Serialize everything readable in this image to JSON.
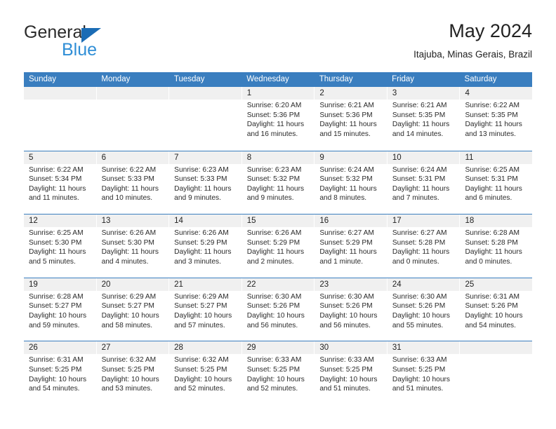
{
  "brand": {
    "name_top": "General",
    "name_bottom": "Blue",
    "triangle_color": "#1b6cb5",
    "blue_text_color": "#2f8ed6"
  },
  "header": {
    "title": "May 2024",
    "subtitle": "Itajuba, Minas Gerais, Brazil"
  },
  "theme": {
    "header_blue": "#3a7ebf",
    "day_band_gray": "#f0f0f0",
    "text": "#222222"
  },
  "calendar": {
    "weekdays": [
      "Sunday",
      "Monday",
      "Tuesday",
      "Wednesday",
      "Thursday",
      "Friday",
      "Saturday"
    ],
    "weeks": [
      [
        {
          "day": "",
          "sunrise": "",
          "sunset": "",
          "daylight": "",
          "daylight2": "",
          "empty": true
        },
        {
          "day": "",
          "sunrise": "",
          "sunset": "",
          "daylight": "",
          "daylight2": "",
          "empty": true
        },
        {
          "day": "",
          "sunrise": "",
          "sunset": "",
          "daylight": "",
          "daylight2": "",
          "empty": true
        },
        {
          "day": "1",
          "sunrise": "Sunrise: 6:20 AM",
          "sunset": "Sunset: 5:36 PM",
          "daylight": "Daylight: 11 hours",
          "daylight2": "and 16 minutes."
        },
        {
          "day": "2",
          "sunrise": "Sunrise: 6:21 AM",
          "sunset": "Sunset: 5:36 PM",
          "daylight": "Daylight: 11 hours",
          "daylight2": "and 15 minutes."
        },
        {
          "day": "3",
          "sunrise": "Sunrise: 6:21 AM",
          "sunset": "Sunset: 5:35 PM",
          "daylight": "Daylight: 11 hours",
          "daylight2": "and 14 minutes."
        },
        {
          "day": "4",
          "sunrise": "Sunrise: 6:22 AM",
          "sunset": "Sunset: 5:35 PM",
          "daylight": "Daylight: 11 hours",
          "daylight2": "and 13 minutes."
        }
      ],
      [
        {
          "day": "5",
          "sunrise": "Sunrise: 6:22 AM",
          "sunset": "Sunset: 5:34 PM",
          "daylight": "Daylight: 11 hours",
          "daylight2": "and 11 minutes."
        },
        {
          "day": "6",
          "sunrise": "Sunrise: 6:22 AM",
          "sunset": "Sunset: 5:33 PM",
          "daylight": "Daylight: 11 hours",
          "daylight2": "and 10 minutes."
        },
        {
          "day": "7",
          "sunrise": "Sunrise: 6:23 AM",
          "sunset": "Sunset: 5:33 PM",
          "daylight": "Daylight: 11 hours",
          "daylight2": "and 9 minutes."
        },
        {
          "day": "8",
          "sunrise": "Sunrise: 6:23 AM",
          "sunset": "Sunset: 5:32 PM",
          "daylight": "Daylight: 11 hours",
          "daylight2": "and 9 minutes."
        },
        {
          "day": "9",
          "sunrise": "Sunrise: 6:24 AM",
          "sunset": "Sunset: 5:32 PM",
          "daylight": "Daylight: 11 hours",
          "daylight2": "and 8 minutes."
        },
        {
          "day": "10",
          "sunrise": "Sunrise: 6:24 AM",
          "sunset": "Sunset: 5:31 PM",
          "daylight": "Daylight: 11 hours",
          "daylight2": "and 7 minutes."
        },
        {
          "day": "11",
          "sunrise": "Sunrise: 6:25 AM",
          "sunset": "Sunset: 5:31 PM",
          "daylight": "Daylight: 11 hours",
          "daylight2": "and 6 minutes."
        }
      ],
      [
        {
          "day": "12",
          "sunrise": "Sunrise: 6:25 AM",
          "sunset": "Sunset: 5:30 PM",
          "daylight": "Daylight: 11 hours",
          "daylight2": "and 5 minutes."
        },
        {
          "day": "13",
          "sunrise": "Sunrise: 6:26 AM",
          "sunset": "Sunset: 5:30 PM",
          "daylight": "Daylight: 11 hours",
          "daylight2": "and 4 minutes."
        },
        {
          "day": "14",
          "sunrise": "Sunrise: 6:26 AM",
          "sunset": "Sunset: 5:29 PM",
          "daylight": "Daylight: 11 hours",
          "daylight2": "and 3 minutes."
        },
        {
          "day": "15",
          "sunrise": "Sunrise: 6:26 AM",
          "sunset": "Sunset: 5:29 PM",
          "daylight": "Daylight: 11 hours",
          "daylight2": "and 2 minutes."
        },
        {
          "day": "16",
          "sunrise": "Sunrise: 6:27 AM",
          "sunset": "Sunset: 5:29 PM",
          "daylight": "Daylight: 11 hours",
          "daylight2": "and 1 minute."
        },
        {
          "day": "17",
          "sunrise": "Sunrise: 6:27 AM",
          "sunset": "Sunset: 5:28 PM",
          "daylight": "Daylight: 11 hours",
          "daylight2": "and 0 minutes."
        },
        {
          "day": "18",
          "sunrise": "Sunrise: 6:28 AM",
          "sunset": "Sunset: 5:28 PM",
          "daylight": "Daylight: 11 hours",
          "daylight2": "and 0 minutes."
        }
      ],
      [
        {
          "day": "19",
          "sunrise": "Sunrise: 6:28 AM",
          "sunset": "Sunset: 5:27 PM",
          "daylight": "Daylight: 10 hours",
          "daylight2": "and 59 minutes."
        },
        {
          "day": "20",
          "sunrise": "Sunrise: 6:29 AM",
          "sunset": "Sunset: 5:27 PM",
          "daylight": "Daylight: 10 hours",
          "daylight2": "and 58 minutes."
        },
        {
          "day": "21",
          "sunrise": "Sunrise: 6:29 AM",
          "sunset": "Sunset: 5:27 PM",
          "daylight": "Daylight: 10 hours",
          "daylight2": "and 57 minutes."
        },
        {
          "day": "22",
          "sunrise": "Sunrise: 6:30 AM",
          "sunset": "Sunset: 5:26 PM",
          "daylight": "Daylight: 10 hours",
          "daylight2": "and 56 minutes."
        },
        {
          "day": "23",
          "sunrise": "Sunrise: 6:30 AM",
          "sunset": "Sunset: 5:26 PM",
          "daylight": "Daylight: 10 hours",
          "daylight2": "and 56 minutes."
        },
        {
          "day": "24",
          "sunrise": "Sunrise: 6:30 AM",
          "sunset": "Sunset: 5:26 PM",
          "daylight": "Daylight: 10 hours",
          "daylight2": "and 55 minutes."
        },
        {
          "day": "25",
          "sunrise": "Sunrise: 6:31 AM",
          "sunset": "Sunset: 5:26 PM",
          "daylight": "Daylight: 10 hours",
          "daylight2": "and 54 minutes."
        }
      ],
      [
        {
          "day": "26",
          "sunrise": "Sunrise: 6:31 AM",
          "sunset": "Sunset: 5:25 PM",
          "daylight": "Daylight: 10 hours",
          "daylight2": "and 54 minutes."
        },
        {
          "day": "27",
          "sunrise": "Sunrise: 6:32 AM",
          "sunset": "Sunset: 5:25 PM",
          "daylight": "Daylight: 10 hours",
          "daylight2": "and 53 minutes."
        },
        {
          "day": "28",
          "sunrise": "Sunrise: 6:32 AM",
          "sunset": "Sunset: 5:25 PM",
          "daylight": "Daylight: 10 hours",
          "daylight2": "and 52 minutes."
        },
        {
          "day": "29",
          "sunrise": "Sunrise: 6:33 AM",
          "sunset": "Sunset: 5:25 PM",
          "daylight": "Daylight: 10 hours",
          "daylight2": "and 52 minutes."
        },
        {
          "day": "30",
          "sunrise": "Sunrise: 6:33 AM",
          "sunset": "Sunset: 5:25 PM",
          "daylight": "Daylight: 10 hours",
          "daylight2": "and 51 minutes."
        },
        {
          "day": "31",
          "sunrise": "Sunrise: 6:33 AM",
          "sunset": "Sunset: 5:25 PM",
          "daylight": "Daylight: 10 hours",
          "daylight2": "and 51 minutes."
        },
        {
          "day": "",
          "sunrise": "",
          "sunset": "",
          "daylight": "",
          "daylight2": "",
          "empty": true
        }
      ]
    ]
  }
}
